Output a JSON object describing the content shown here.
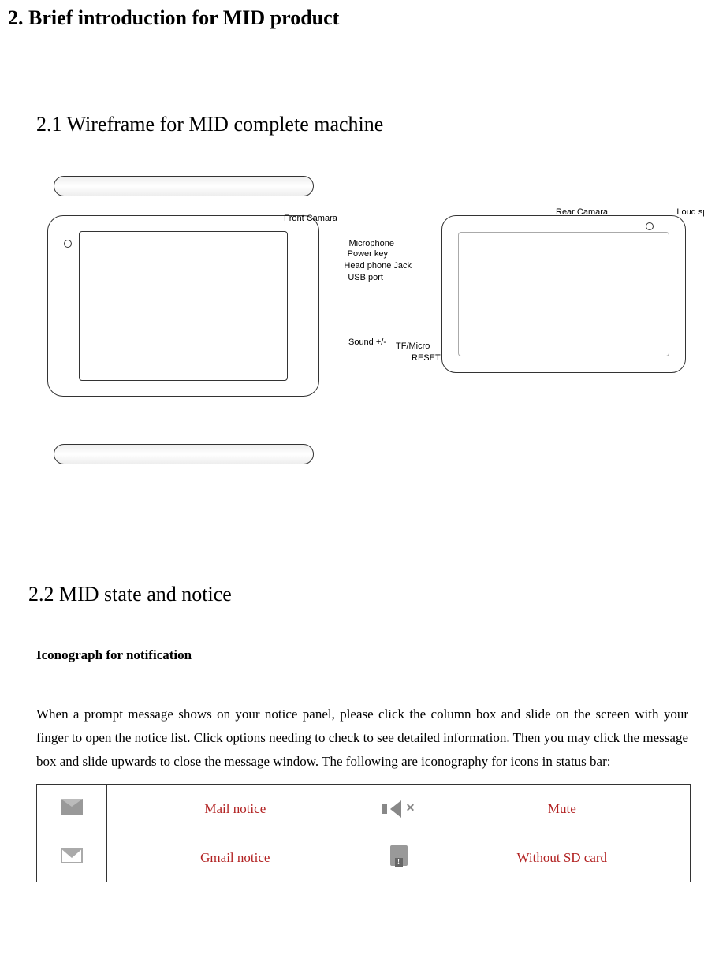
{
  "section": {
    "heading": "2. Brief introduction for MID product"
  },
  "subsection1": {
    "heading": "2.1 Wireframe for MID complete machine"
  },
  "wireframe": {
    "labels": {
      "front_camera": "Front Camara",
      "microphone": "Microphone",
      "power_key": "Power key",
      "headphone": "Head phone Jack",
      "usb": "USB port",
      "sound": "Sound +/-",
      "rear_camera": "Rear Camara",
      "loud_speaker": "Loud speaker",
      "tf_micro": "TF/Micro",
      "reset": "RESET"
    }
  },
  "subsection2": {
    "heading": "2.2 MID state and notice"
  },
  "iconograph": {
    "heading": "Iconograph for notification",
    "paragraph": "When a prompt message shows on your notice panel, please click the column box and slide on the screen with your finger to open the notice list. Click options needing to check to see detailed information. Then you may click the message box and slide upwards to close the message window. The following are iconography for icons in status bar:"
  },
  "table": {
    "rows": [
      {
        "desc1": "Mail notice",
        "desc2": "Mute"
      },
      {
        "desc1": "Gmail notice",
        "desc2": "Without SD card"
      }
    ]
  }
}
